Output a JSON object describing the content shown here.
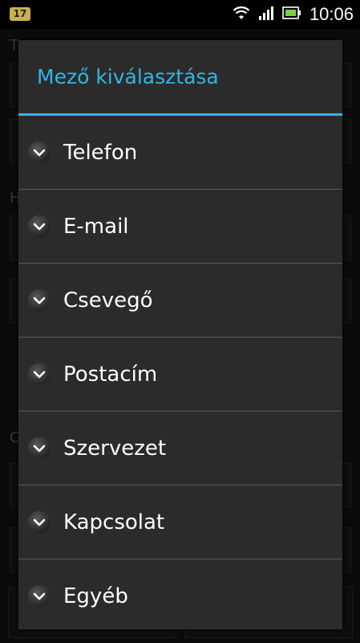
{
  "status_bar": {
    "notification_count": "17",
    "time": "10:06",
    "icons": [
      "wifi-icon",
      "signal-icon",
      "battery-icon"
    ]
  },
  "background": {
    "letters": [
      "T",
      "H",
      "C"
    ]
  },
  "dialog": {
    "title": "Mező kiválasztása",
    "options": [
      {
        "label": "Telefon",
        "icon": "chevron-down-icon"
      },
      {
        "label": "E-mail",
        "icon": "chevron-down-icon"
      },
      {
        "label": "Csevegő",
        "icon": "chevron-down-icon"
      },
      {
        "label": "Postacím",
        "icon": "chevron-down-icon"
      },
      {
        "label": "Szervezet",
        "icon": "chevron-down-icon"
      },
      {
        "label": "Kapcsolat",
        "icon": "chevron-down-icon"
      },
      {
        "label": "Egyéb",
        "icon": "chevron-down-icon"
      }
    ]
  },
  "colors": {
    "accent": "#33b5e5",
    "dialog_bg": "#2b2b2b",
    "divider": "#595959"
  }
}
